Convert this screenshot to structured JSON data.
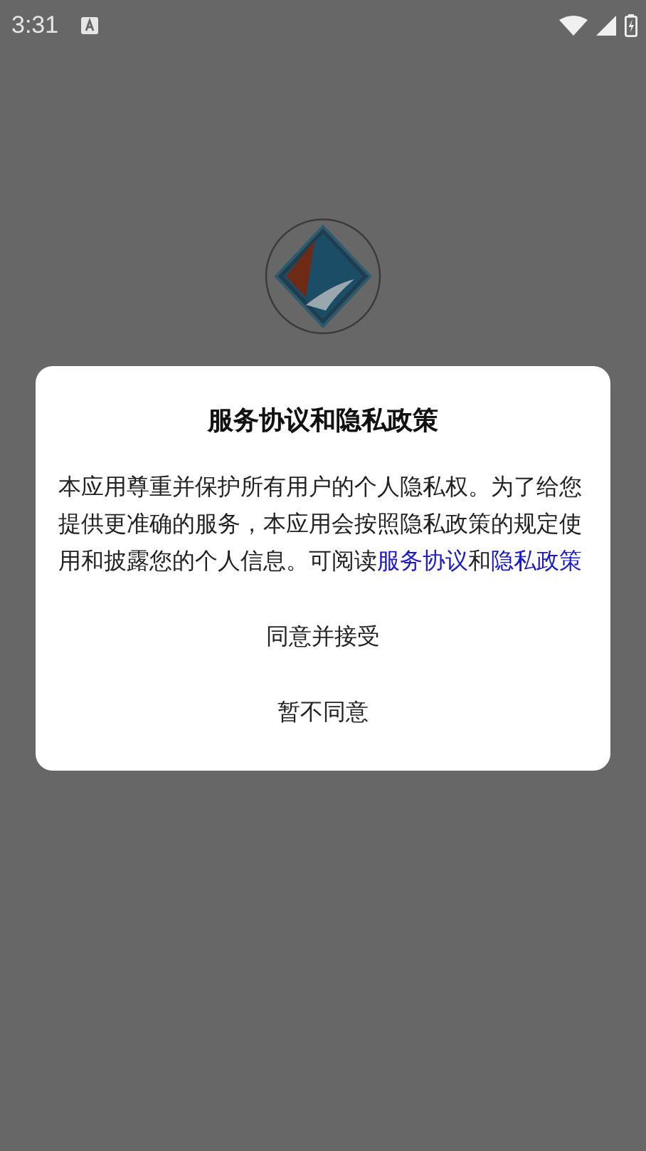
{
  "status_bar": {
    "time": "3:31"
  },
  "dialog": {
    "title": "服务协议和隐私政策",
    "body": [
      {
        "kind": "text",
        "text": "本应用尊重并保护所有用户的个人隐私权。为了给您提供更准确的服务，本应用会按照隐私政策的规定使用和披露您的个人信息。可阅读"
      },
      {
        "kind": "link",
        "text": "服务协议"
      },
      {
        "kind": "text",
        "text": "和"
      },
      {
        "kind": "link",
        "text": "隐私政策"
      }
    ],
    "buttons": [
      "同意并接受",
      "暂不同意"
    ]
  }
}
